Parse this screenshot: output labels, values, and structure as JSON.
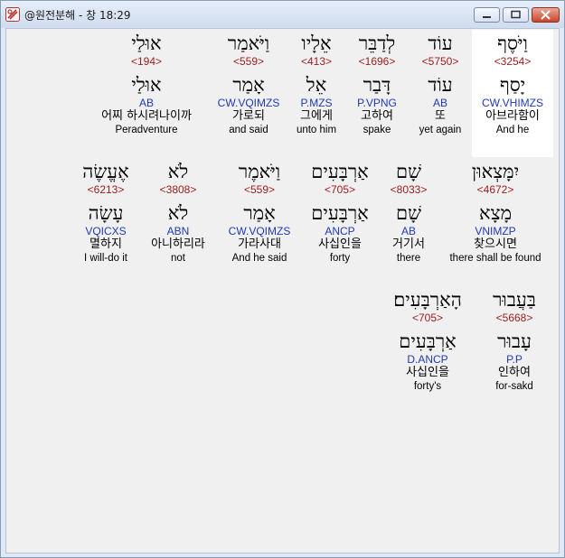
{
  "window": {
    "title": "@원전분해 - 창 18:29",
    "accent": "#1f39b8",
    "strong_color": "#9b1c1c"
  },
  "row1": [
    {
      "word": "וַיֹּסֶף",
      "strong": "<3254>",
      "lemma": "יָסַף",
      "morph": "CW.VHIMZS",
      "korean": "아브라함이",
      "english": "And he"
    },
    {
      "word": "עוֹד",
      "strong": "<5750>",
      "lemma": "עוֹד",
      "morph": "AB",
      "korean": "또",
      "english": "yet again"
    },
    {
      "word": "לְדַבֵּר",
      "strong": "<1696>",
      "lemma": "דָּבַר",
      "morph": "P.VPNG",
      "korean": "고하여",
      "english": "spake"
    },
    {
      "word": "אֵלָיו",
      "strong": "<413>",
      "lemma": "אֵל",
      "morph": "P.MZS",
      "korean": "그에게",
      "english": "unto him"
    },
    {
      "word": "וַיֹּאמַר",
      "strong": "<559>",
      "lemma": "אָמַר",
      "morph": "CW.VQIMZS",
      "korean": "가로되",
      "english": "and said"
    },
    {
      "word": "אוּלַי",
      "strong": "<194>",
      "lemma": "אוּלַי",
      "morph": "AB",
      "korean": "어찌 하시려나이까",
      "english": "Peradventure"
    }
  ],
  "row2": [
    {
      "word": "יִמָּצְאוּן",
      "strong": "<4672>",
      "lemma": "מָצָא",
      "morph": "VNIMZP",
      "korean": "찾으시면",
      "english": "there shall be found"
    },
    {
      "word": "שָׁם",
      "strong": "<8033>",
      "lemma": "שָׁם",
      "morph": "AB",
      "korean": "거기서",
      "english": "there"
    },
    {
      "word": "אַרְבָּעִים",
      "strong": "<705>",
      "lemma": "אַרְבָּעִים",
      "morph": "ANCP",
      "korean": "사십인을",
      "english": "forty"
    },
    {
      "word": "וַיֹּאמֶר",
      "strong": "<559>",
      "lemma": "אָמַר",
      "morph": "CW.VQIMZS",
      "korean": "가라사대",
      "english": "And he said"
    },
    {
      "word": "לֹא",
      "strong": "<3808>",
      "lemma": "לֹא",
      "morph": "ABN",
      "korean": "아니하리라",
      "english": "not"
    },
    {
      "word": "אֶעֱשֶׂה",
      "strong": "<6213>",
      "lemma": "עָשָׂה",
      "morph": "VQICXS",
      "korean": "멸하지",
      "english": "I will-do it"
    }
  ],
  "row3": [
    {
      "word": "בַּעֲבוּר",
      "strong": "<5668>",
      "lemma": "עָבוּר",
      "morph": "P.P",
      "korean": "인하여",
      "english": "for-sakd"
    },
    {
      "word": "הָאַרְבָּעִים׃",
      "strong": "<705>",
      "lemma": "אַרְבָּעִים",
      "morph": "D.ANCP",
      "korean": "사십인을",
      "english": "forty's"
    }
  ]
}
